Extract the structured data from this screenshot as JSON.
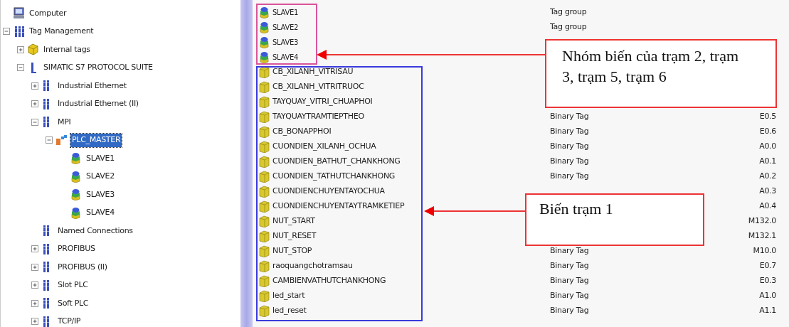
{
  "tree": [
    {
      "label": "Computer",
      "kind": "computer",
      "selected": false
    },
    {
      "label": "Tag Management",
      "kind": "tag-management",
      "selected": false,
      "expanded": true,
      "children": [
        {
          "label": "Internal tags",
          "kind": "internal-tags",
          "selected": false,
          "expanded": false
        },
        {
          "label": "SIMATIC S7 PROTOCOL SUITE",
          "kind": "protocol-suite",
          "selected": false,
          "expanded": true,
          "children": [
            {
              "label": "Industrial Ethernet",
              "kind": "channel",
              "selected": false,
              "expanded": false
            },
            {
              "label": "Industrial Ethernet (II)",
              "kind": "channel",
              "selected": false,
              "expanded": false
            },
            {
              "label": "MPI",
              "kind": "channel",
              "selected": false,
              "expanded": true,
              "children": [
                {
                  "label": "PLC_MASTER",
                  "kind": "station",
                  "selected": true,
                  "expanded": true,
                  "children": [
                    {
                      "label": "SLAVE1",
                      "kind": "group",
                      "selected": false
                    },
                    {
                      "label": "SLAVE2",
                      "kind": "group",
                      "selected": false
                    },
                    {
                      "label": "SLAVE3",
                      "kind": "group",
                      "selected": false
                    },
                    {
                      "label": "SLAVE4",
                      "kind": "group",
                      "selected": false
                    }
                  ]
                }
              ]
            },
            {
              "label": "Named Connections",
              "kind": "channel",
              "selected": false
            },
            {
              "label": "PROFIBUS",
              "kind": "channel",
              "selected": false,
              "expanded": false
            },
            {
              "label": "PROFIBUS (II)",
              "kind": "channel",
              "selected": false,
              "expanded": false
            },
            {
              "label": "Slot PLC",
              "kind": "channel",
              "selected": false,
              "expanded": false
            },
            {
              "label": "Soft PLC",
              "kind": "channel",
              "selected": false,
              "expanded": false
            },
            {
              "label": "TCP/IP",
              "kind": "channel",
              "selected": false,
              "expanded": false
            }
          ]
        }
      ]
    }
  ],
  "tag_list": {
    "groups": [
      {
        "color": "#d9559a",
        "rows": [
          {
            "name": "SLAVE1",
            "kind": "group",
            "type": "Tag group"
          },
          {
            "name": "SLAVE2",
            "kind": "group",
            "type": "Tag group"
          },
          {
            "name": "SLAVE3",
            "kind": "group"
          },
          {
            "name": "SLAVE4",
            "kind": "group"
          }
        ]
      },
      {
        "color": "#3a3adc",
        "rows": [
          {
            "name": "CB_XILANH_VITRISAU",
            "kind": "tag"
          },
          {
            "name": "CB_XILANH_VITRITRUOC",
            "kind": "tag"
          },
          {
            "name": "TAYQUAY_VITRI_CHUAPHOI",
            "kind": "tag"
          },
          {
            "name": "TAYQUAYTRAMTIEPTHEO",
            "kind": "tag",
            "type": "Binary Tag",
            "address": "E0.5"
          },
          {
            "name": "CB_BONAPPHOI",
            "kind": "tag",
            "type": "Binary Tag",
            "address": "E0.6"
          },
          {
            "name": "CUONDIEN_XILANH_OCHUA",
            "kind": "tag",
            "type": "Binary Tag",
            "address": "A0.0"
          },
          {
            "name": "CUONDIEN_BATHUT_CHANKHONG",
            "kind": "tag",
            "type": "Binary Tag",
            "address": "A0.1"
          },
          {
            "name": "CUONDIEN_TATHUTCHANKHONG",
            "kind": "tag",
            "type": "Binary Tag",
            "address": "A0.2"
          },
          {
            "name": "CUONDIENCHUYENTAYOCHUA",
            "kind": "tag",
            "address": "A0.3"
          },
          {
            "name": "CUONDIENCHUYENTAYTRAMKETIEP",
            "kind": "tag",
            "address": "A0.4"
          },
          {
            "name": "NUT_START",
            "kind": "tag",
            "address": "M132.0"
          },
          {
            "name": "NUT_RESET",
            "kind": "tag",
            "address": "M132.1"
          },
          {
            "name": "NUT_STOP",
            "kind": "tag",
            "type": "Binary Tag",
            "address": "M10.0"
          },
          {
            "name": "raoquangchotramsau",
            "kind": "tag",
            "type": "Binary Tag",
            "address": "E0.7"
          },
          {
            "name": "CAMBIENVATHUTCHANKHONG",
            "kind": "tag",
            "type": "Binary Tag",
            "address": "E0.3"
          },
          {
            "name": "led_start",
            "kind": "tag",
            "type": "Binary Tag",
            "address": "A1.0"
          },
          {
            "name": "led_reset",
            "kind": "tag",
            "type": "Binary Tag",
            "address": "A1.1"
          }
        ]
      }
    ]
  },
  "callouts": [
    {
      "text": "Nhóm biến của trạm 2, trạm 3, trạm 5, trạm 6"
    },
    {
      "text": "Biến trạm 1"
    }
  ]
}
